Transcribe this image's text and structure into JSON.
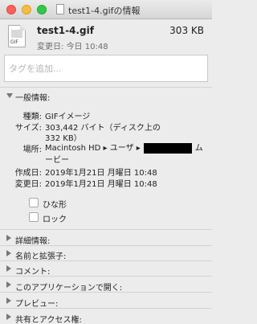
{
  "window": {
    "title": "test1-4.gifの情報"
  },
  "header": {
    "file_name": "test1-4.gif",
    "file_size": "303 KB",
    "modified_label": "変更日:",
    "modified_value": "今日 10:48",
    "icon_badge": "GIF"
  },
  "tags": {
    "placeholder": "タグを追加..."
  },
  "general": {
    "heading": "一般情報:",
    "rows": {
      "kind_label": "種類:",
      "kind_value": "GIFイメージ",
      "size_label": "サイズ:",
      "size_value_line1": "303,442 バイト（ディスク上の",
      "size_value_line2": "332 KB）",
      "location_label": "場所:",
      "location_part1": "Macintosh HD",
      "location_sep1": "▸",
      "location_part2": "ユーザ",
      "location_sep2": "▸",
      "location_part3": "ム",
      "location_part4": "ービー",
      "created_label": "作成日:",
      "created_value": "2019年1月21日 月曜日 10:48",
      "modified_label": "変更日:",
      "modified_value": "2019年1月21日 月曜日 10:48"
    },
    "checkboxes": [
      {
        "label": "ひな形",
        "checked": false
      },
      {
        "label": "ロック",
        "checked": false
      }
    ]
  },
  "sections": [
    "詳細情報:",
    "名前と拡張子:",
    "コメント:",
    "このアプリケーションで開く:",
    "プレビュー:",
    "共有とアクセス権:"
  ]
}
